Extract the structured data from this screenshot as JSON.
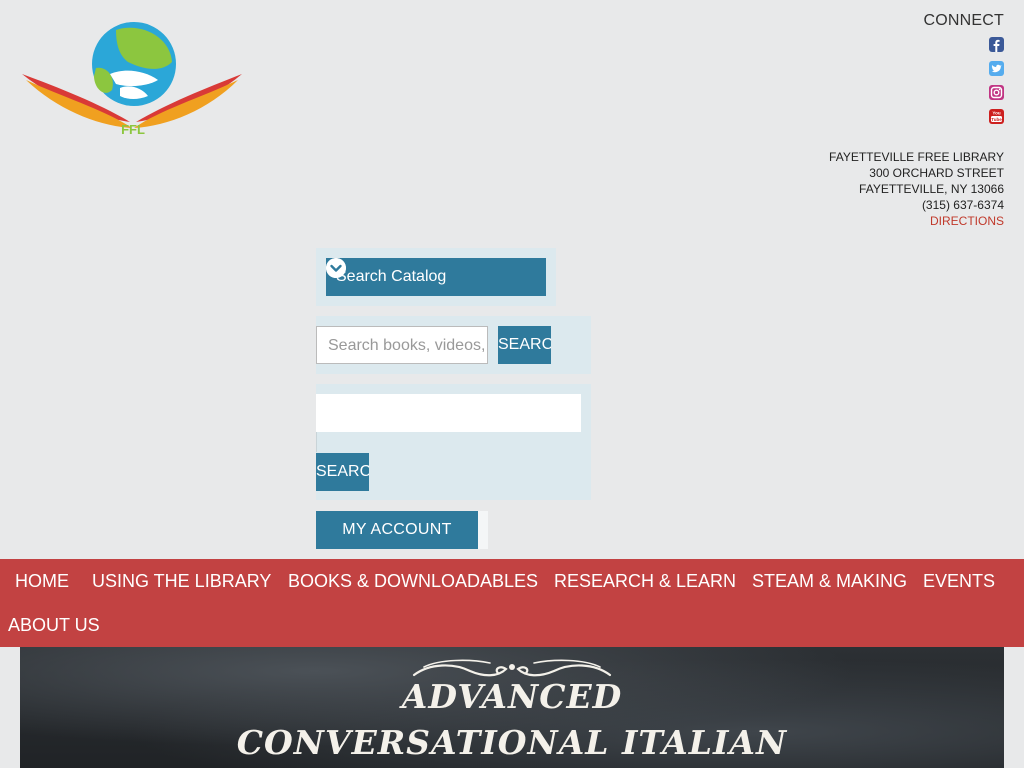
{
  "logo": {
    "text": "FFL"
  },
  "connect": {
    "title": "CONNECT",
    "social": [
      {
        "icon": "facebook-icon",
        "color": "#3b5998"
      },
      {
        "icon": "twitter-icon",
        "color": "#55acee"
      },
      {
        "icon": "instagram-icon",
        "color": "#c13584"
      },
      {
        "icon": "youtube-icon",
        "color": "#cd201f"
      }
    ]
  },
  "address": {
    "name": "FAYETTEVILLE FREE LIBRARY",
    "street": "300 ORCHARD STREET",
    "city": "FAYETTEVILLE, NY 13066",
    "phone": "(315) 637-6374",
    "directions": "DIRECTIONS"
  },
  "catalog": {
    "selected": "Search Catalog",
    "search_placeholder": "Search books, videos, music and more",
    "search_button": "SEARCH",
    "keyword_button": "SEARCH",
    "account_button": "MY ACCOUNT"
  },
  "nav": {
    "items": [
      "HOME",
      "USING THE LIBRARY",
      "BOOKS & DOWNLOADABLES",
      "RESEARCH & LEARN",
      "STEAM & MAKING",
      "EVENTS",
      "ABOUT US"
    ]
  },
  "banner": {
    "line1": "ADVANCED",
    "line2": "CONVERSATIONAL ITALIAN"
  },
  "colors": {
    "brand_blue": "#2f7a9c",
    "nav_red": "#c24242",
    "link_red": "#c0392b"
  }
}
